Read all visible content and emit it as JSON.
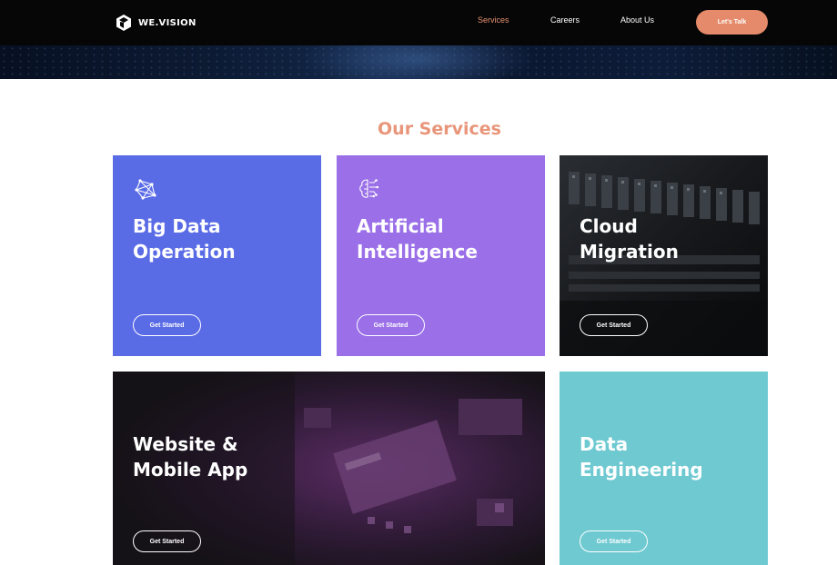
{
  "header": {
    "logo_text": "WE.VISION",
    "nav": {
      "services": "Services",
      "careers": "Careers",
      "about": "About Us"
    },
    "cta_label": "Let's Talk"
  },
  "section": {
    "title": "Our Services"
  },
  "cards": [
    {
      "title": "Big Data\nOperation",
      "button": "Get Started",
      "color": "#5a6be6",
      "icon": "network-icon"
    },
    {
      "title": "Artificial\nIntelligence",
      "button": "Get Started",
      "color": "#9a6fe8",
      "icon": "brain-icon"
    },
    {
      "title": "Cloud\nMigration",
      "button": "Get Started",
      "color": "#101214"
    },
    {
      "title": "Website &\nMobile App",
      "button": "Get Started",
      "color": "#1d1622"
    },
    {
      "title": "Data\nEngineering",
      "button": "Get Started",
      "color": "#6ec9d1"
    }
  ],
  "colors": {
    "accent": "#e58a6a",
    "header_bg": "#060606"
  }
}
